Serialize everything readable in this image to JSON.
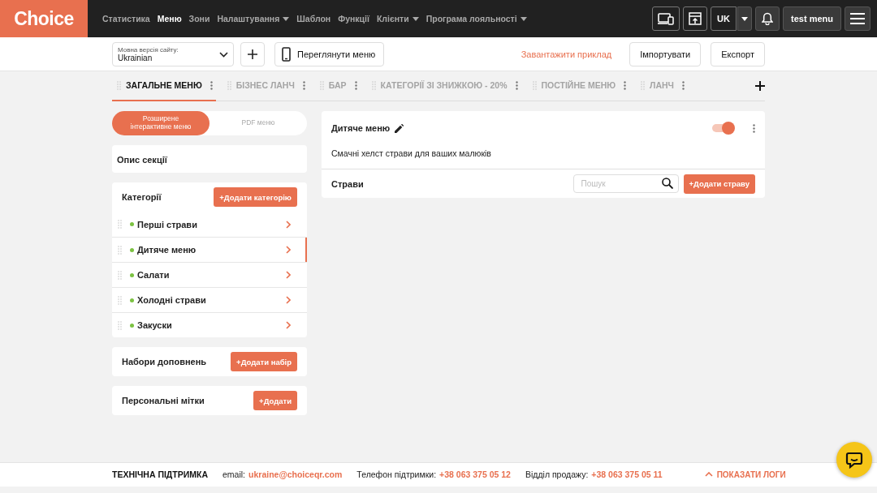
{
  "header": {
    "logo": "Choice",
    "nav": [
      {
        "label": "Статистика",
        "selected": false,
        "dropdown": false
      },
      {
        "label": "Меню",
        "selected": true,
        "dropdown": false
      },
      {
        "label": "Зони",
        "selected": false,
        "dropdown": false
      },
      {
        "label": "Налаштування",
        "selected": false,
        "dropdown": true
      },
      {
        "label": "Шаблон",
        "selected": false,
        "dropdown": false
      },
      {
        "label": "Функції",
        "selected": false,
        "dropdown": false
      },
      {
        "label": "Клієнти",
        "selected": false,
        "dropdown": true
      },
      {
        "label": "Програма лояльності",
        "selected": false,
        "dropdown": true
      }
    ],
    "language": "UK",
    "user": "test menu"
  },
  "toolbar": {
    "language_select": {
      "label": "Мовна версія сайту:",
      "value": "Ukrainian"
    },
    "preview_button": "Переглянути меню",
    "download_link": "Завантажити приклад",
    "import_button": "Імпортувати",
    "export_button": "Експорт"
  },
  "tabs": [
    {
      "label": "ЗАГАЛЬНЕ МЕНЮ",
      "selected": true
    },
    {
      "label": "БІЗНЕС ЛАНЧ",
      "selected": false
    },
    {
      "label": "БАР",
      "selected": false
    },
    {
      "label": "КАТЕГОРІЇ ЗІ ЗНИЖКОЮ - 20%",
      "selected": false
    },
    {
      "label": "ПОСТІЙНЕ МЕНЮ",
      "selected": false
    },
    {
      "label": "ЛАНЧ",
      "selected": false
    }
  ],
  "mode_switch": [
    {
      "label": "Розширене інтерактивне меню",
      "selected": true
    },
    {
      "label": "PDF меню",
      "selected": false
    }
  ],
  "section_description": "Опис секції",
  "categories": {
    "title": "Категорії",
    "add_button": "+Додати категорію",
    "items": [
      {
        "label": "Перші страви",
        "selected": false,
        "color": "#7cc242"
      },
      {
        "label": "Дитяче меню",
        "selected": true,
        "color": "#7cc242"
      },
      {
        "label": "Салати",
        "selected": false,
        "color": "#7cc242"
      },
      {
        "label": "Холодні страви",
        "selected": false,
        "color": "#7cc242"
      },
      {
        "label": "Закуски",
        "selected": false,
        "color": "#7cc242"
      }
    ]
  },
  "addon_sets": {
    "title": "Набори доповнень",
    "add_button": "+Додати набір"
  },
  "personal_tags": {
    "title": "Персональні мітки",
    "add_button": "+Додати"
  },
  "category_detail": {
    "title": "Дитяче меню",
    "enabled": true,
    "description": "Смачні хелст страви для ваших малюків",
    "dishes_label": "Страви",
    "search_placeholder": "Пошук",
    "add_button": "+Додати страву"
  },
  "footer": {
    "title": "ТЕХНІЧНА ПІДТРИМКА",
    "email_label": "email:",
    "email": "ukraine@choiceqr.com",
    "phone_label": "Телефон підтримки:",
    "phone": "+38 063 375 05 12",
    "sales_label": "Відділ продажу:",
    "sales_phone": "+38 063 375 05 11",
    "logs_button": "ПОКАЗАТИ ЛОГИ"
  }
}
